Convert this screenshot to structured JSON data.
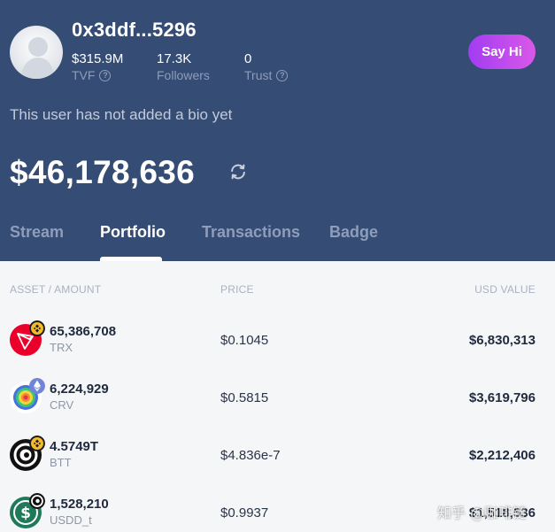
{
  "profile": {
    "username": "0x3ddf...5296",
    "bio": "This user has not added a bio yet",
    "say_hi_label": "Say Hi",
    "stats": [
      {
        "value": "$315.9M",
        "label": "TVF"
      },
      {
        "value": "17.3K",
        "label": "Followers"
      },
      {
        "value": "0",
        "label": "Trust"
      }
    ],
    "total_value": "$46,178,636"
  },
  "tabs": [
    {
      "label": "Stream"
    },
    {
      "label": "Portfolio"
    },
    {
      "label": "Transactions"
    },
    {
      "label": "Badge"
    }
  ],
  "active_tab": "Portfolio",
  "table": {
    "headers": {
      "asset": "ASSET / AMOUNT",
      "price": "PRICE",
      "usd": "USD VALUE"
    },
    "rows": [
      {
        "amount": "65,386,708",
        "symbol": "TRX",
        "price": "$0.1045",
        "usd_value": "$6,830,313",
        "icon": "trx-icon",
        "chain_badge": "bnb-badge-icon"
      },
      {
        "amount": "6,224,929",
        "symbol": "CRV",
        "price": "$0.5815",
        "usd_value": "$3,619,796",
        "icon": "crv-icon",
        "chain_badge": "eth-badge-icon"
      },
      {
        "amount": "4.5749T",
        "symbol": "BTT",
        "price": "$4.836e-7",
        "usd_value": "$2,212,406",
        "icon": "btt-icon",
        "chain_badge": "bnb-badge-icon"
      },
      {
        "amount": "1,528,210",
        "symbol": "USDD_t",
        "price": "$0.9937",
        "usd_value": "$1,518,536",
        "icon": "usdd-icon",
        "chain_badge": "tron-badge-icon"
      }
    ]
  },
  "colors": {
    "header_bg": "#354c74",
    "muted": "#8e9dbb",
    "accent_from": "#a23cf2",
    "accent_to": "#d958e9",
    "body_bg": "#f5f6f8"
  },
  "watermark": "知乎 @咖啡链"
}
